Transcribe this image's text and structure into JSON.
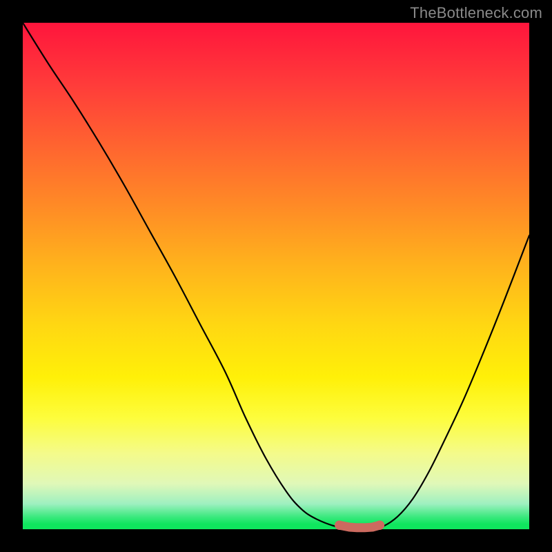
{
  "watermark": "TheBottleneck.com",
  "colors": {
    "frame": "#000000",
    "curve": "#000000",
    "marker_fill": "#cc6a5f",
    "marker_stroke": "#333333"
  },
  "chart_data": {
    "type": "line",
    "title": "",
    "xlabel": "",
    "ylabel": "",
    "xlim": [
      0,
      100
    ],
    "ylim": [
      0,
      100
    ],
    "grid": false,
    "series": [
      {
        "name": "bottleneck-curve",
        "x": [
          0,
          5,
          10,
          15,
          20,
          25,
          30,
          35,
          40,
          44,
          48,
          52,
          55,
          58,
          62,
          65,
          67,
          69,
          71,
          74,
          77,
          80,
          83,
          87,
          91,
          95,
          100
        ],
        "values": [
          100,
          92,
          84.5,
          76.5,
          68,
          59,
          50,
          40.5,
          31,
          22,
          14,
          7.5,
          4,
          2,
          0.5,
          0.2,
          0.2,
          0.2,
          0.5,
          2.5,
          6,
          11,
          17,
          25.5,
          35,
          45,
          58
        ]
      }
    ],
    "markers": [
      {
        "name": "optimal-range",
        "x": [
          62.5,
          64.5,
          66,
          67.5,
          69,
          70.5
        ],
        "y": [
          0.8,
          0.4,
          0.3,
          0.3,
          0.4,
          0.8
        ]
      }
    ],
    "annotations": []
  }
}
